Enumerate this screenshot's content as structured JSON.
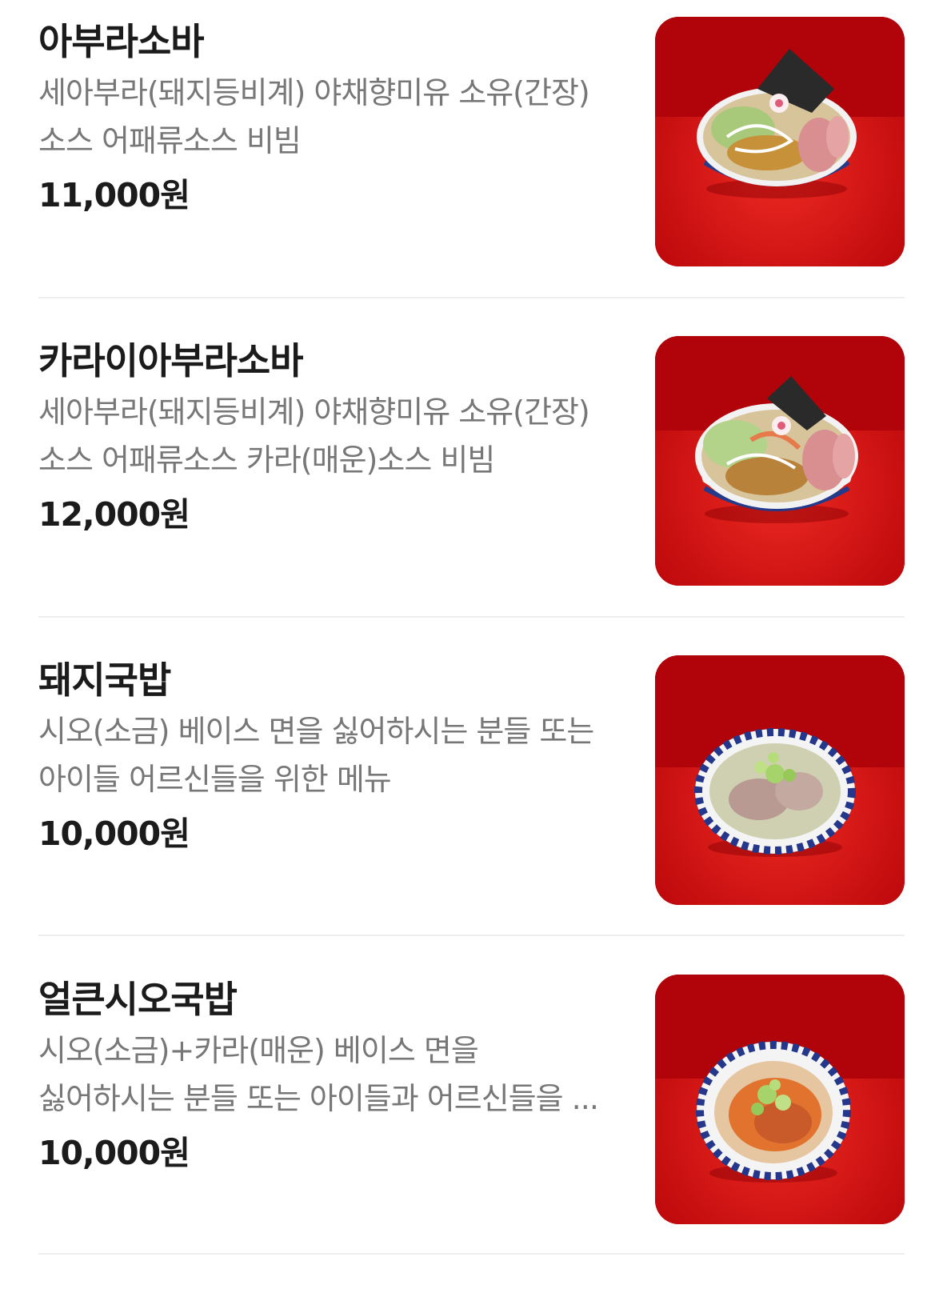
{
  "menu": {
    "items": [
      {
        "name": "아부라소바",
        "description": "세아부라(돼지등비계) 야채향미유 소유(간장)소스 어패류소스 비빔",
        "price": "11,000원",
        "image_label": "bowl of aburasoba with seaweed, narutomaki, pork slices and mayo",
        "icon": "food-photo"
      },
      {
        "name": "카라이아부라소바",
        "description": "세아부라(돼지등비계) 야채향미유 소유(간장)소스 어패류소스 카라(매운)소스 비빔",
        "price": "12,000원",
        "image_label": "bowl of spicy aburasoba with seaweed, narutomaki, pork slices",
        "icon": "food-photo"
      },
      {
        "name": "돼지국밥",
        "description": "시오(소금) 베이스 면을 싫어하시는 분들 또는 아이들 어르신들을 위한 메뉴",
        "price": "10,000원",
        "image_label": "bowl of pork gukbap with green onions",
        "icon": "food-photo"
      },
      {
        "name": "얼큰시오국밥",
        "description": "시오(소금)+카라(매운) 베이스 면을 싫어하시는 분들 또는 아이들과 어르신들을 ...",
        "price": "10,000원",
        "image_label": "bowl of spicy shio gukbap with green onions",
        "icon": "food-photo"
      }
    ]
  },
  "colors": {
    "photo_background": "#c8060a",
    "text_primary": "#1b1b1b",
    "text_secondary": "#777777",
    "divider": "#eeeeee"
  }
}
